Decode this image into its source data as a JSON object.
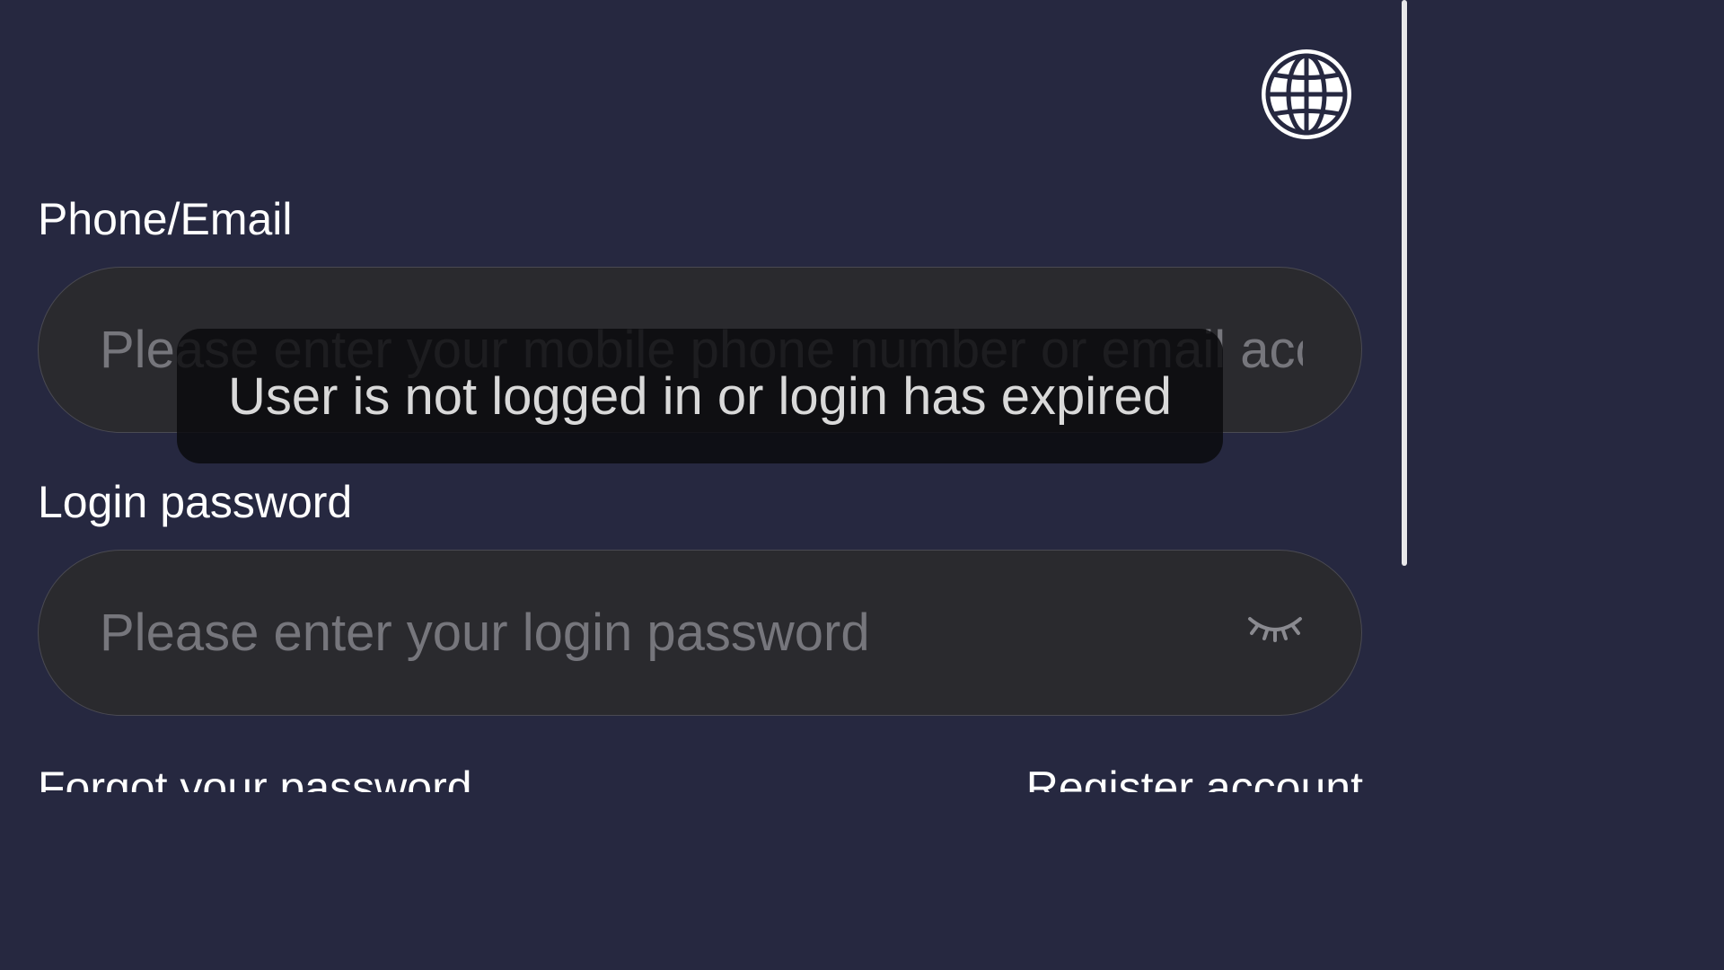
{
  "header": {
    "language_icon": "globe-icon"
  },
  "form": {
    "phone_label": "Phone/Email",
    "phone_placeholder": "Please enter your mobile phone number or email account",
    "phone_value": "",
    "password_label": "Login password",
    "password_placeholder": "Please enter your login password",
    "password_value": "",
    "password_toggle_icon": "eye-closed-icon"
  },
  "links": {
    "forgot_password": "Forgot your password",
    "register": "Register account"
  },
  "toast": {
    "message": "User is not logged in or login has expired"
  },
  "colors": {
    "background": "#262840",
    "input_background": "#2a2a2e",
    "placeholder": "#76767c",
    "text": "#ffffff"
  }
}
